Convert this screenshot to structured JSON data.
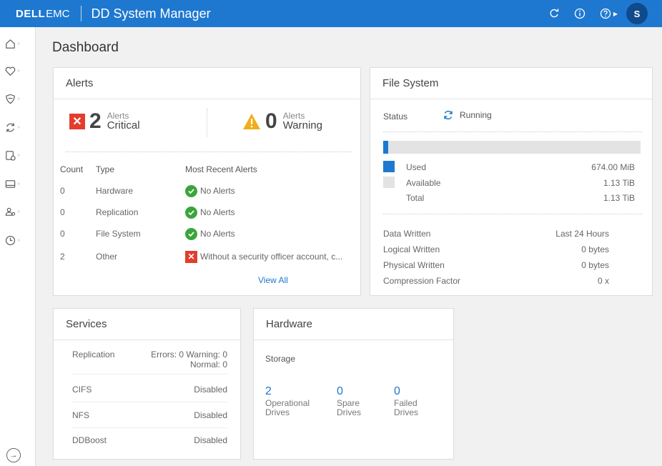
{
  "header": {
    "brand_dell": "DELL",
    "brand_emc": "EMC",
    "app_title": "DD System Manager",
    "user_initial": "S"
  },
  "page": {
    "title": "Dashboard"
  },
  "alerts": {
    "title": "Alerts",
    "critical": {
      "count": "2",
      "label_small": "Alerts",
      "label": "Critical"
    },
    "warning": {
      "count": "0",
      "label_small": "Alerts",
      "label": "Warning"
    },
    "columns": [
      "Count",
      "Type",
      "Most Recent Alerts"
    ],
    "rows": [
      {
        "count": "0",
        "type": "Hardware",
        "message": "No Alerts",
        "status": "ok"
      },
      {
        "count": "0",
        "type": "Replication",
        "message": "No Alerts",
        "status": "ok"
      },
      {
        "count": "0",
        "type": "File System",
        "message": "No Alerts",
        "status": "ok"
      },
      {
        "count": "2",
        "type": "Other",
        "message": "Without a security officer account, c...",
        "status": "error"
      }
    ],
    "view_all": "View All"
  },
  "filesystem": {
    "title": "File System",
    "status_label": "Status",
    "status_value": "Running",
    "used_fraction": 0.02,
    "used_label": "Used",
    "used_value": "674.00 MiB",
    "available_label": "Available",
    "available_value": "1.13 TiB",
    "total_label": "Total",
    "total_value": "1.13 TiB",
    "data_written_label": "Data Written",
    "period": "Last 24 Hours",
    "logical_label": "Logical Written",
    "logical_value": "0 bytes",
    "physical_label": "Physical Written",
    "physical_value": "0 bytes",
    "compression_label": "Compression Factor",
    "compression_value": "0 x",
    "colors": {
      "used": "#1e78d0",
      "available": "#e3e3e3"
    }
  },
  "services": {
    "title": "Services",
    "replication_label": "Replication",
    "replication_value_line1": "Errors: 0 Warning: 0",
    "replication_value_line2": "Normal: 0",
    "cifs_label": "CIFS",
    "cifs_value": "Disabled",
    "nfs_label": "NFS",
    "nfs_value": "Disabled",
    "ddboost_label": "DDBoost",
    "ddboost_value": "Disabled"
  },
  "hardware": {
    "title": "Hardware",
    "storage_label": "Storage",
    "operational": {
      "count": "2",
      "line1": "Operational",
      "line2": "Drives"
    },
    "spare": {
      "count": "0",
      "line1": "Spare",
      "line2": "Drives"
    },
    "failed": {
      "count": "0",
      "line1": "Failed",
      "line2": "Drives"
    }
  },
  "icons": {
    "sidebar": [
      "home-icon",
      "health-icon",
      "data-protection-icon",
      "replication-icon",
      "hardware-icon",
      "reports-icon",
      "administration-icon",
      "maintenance-icon"
    ],
    "topbar": [
      "refresh-icon",
      "info-icon",
      "help-icon"
    ]
  }
}
